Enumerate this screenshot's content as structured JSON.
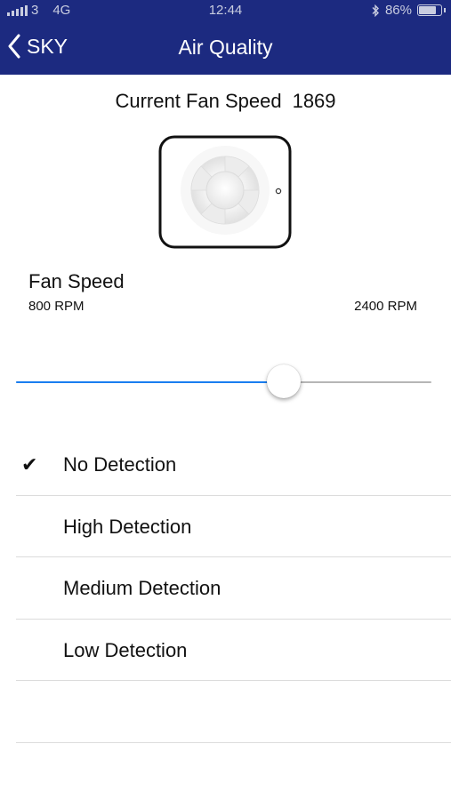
{
  "status_bar": {
    "carrier": "3",
    "network": "4G",
    "time": "12:44",
    "battery_text": "86%",
    "battery_level": 0.86,
    "color": "#c9cde0"
  },
  "nav": {
    "back_label": "SKY",
    "title": "Air Quality",
    "bar_color": "#1c2a80"
  },
  "current_speed": {
    "label": "Current Fan Speed",
    "value": "1869"
  },
  "fan_speed": {
    "label": "Fan Speed",
    "min_label": "800 RPM",
    "max_label": "2400 RPM",
    "min": 800,
    "max": 2400,
    "value": 1830,
    "accent_color": "#1a7ef0"
  },
  "detection_options": [
    {
      "label": "No Detection",
      "checked": true,
      "check_mark": "✔"
    },
    {
      "label": "High Detection",
      "checked": false,
      "check_mark": ""
    },
    {
      "label": "Medium Detection",
      "checked": false,
      "check_mark": ""
    },
    {
      "label": "Low Detection",
      "checked": false,
      "check_mark": ""
    },
    {
      "label": "",
      "checked": false,
      "check_mark": ""
    }
  ]
}
